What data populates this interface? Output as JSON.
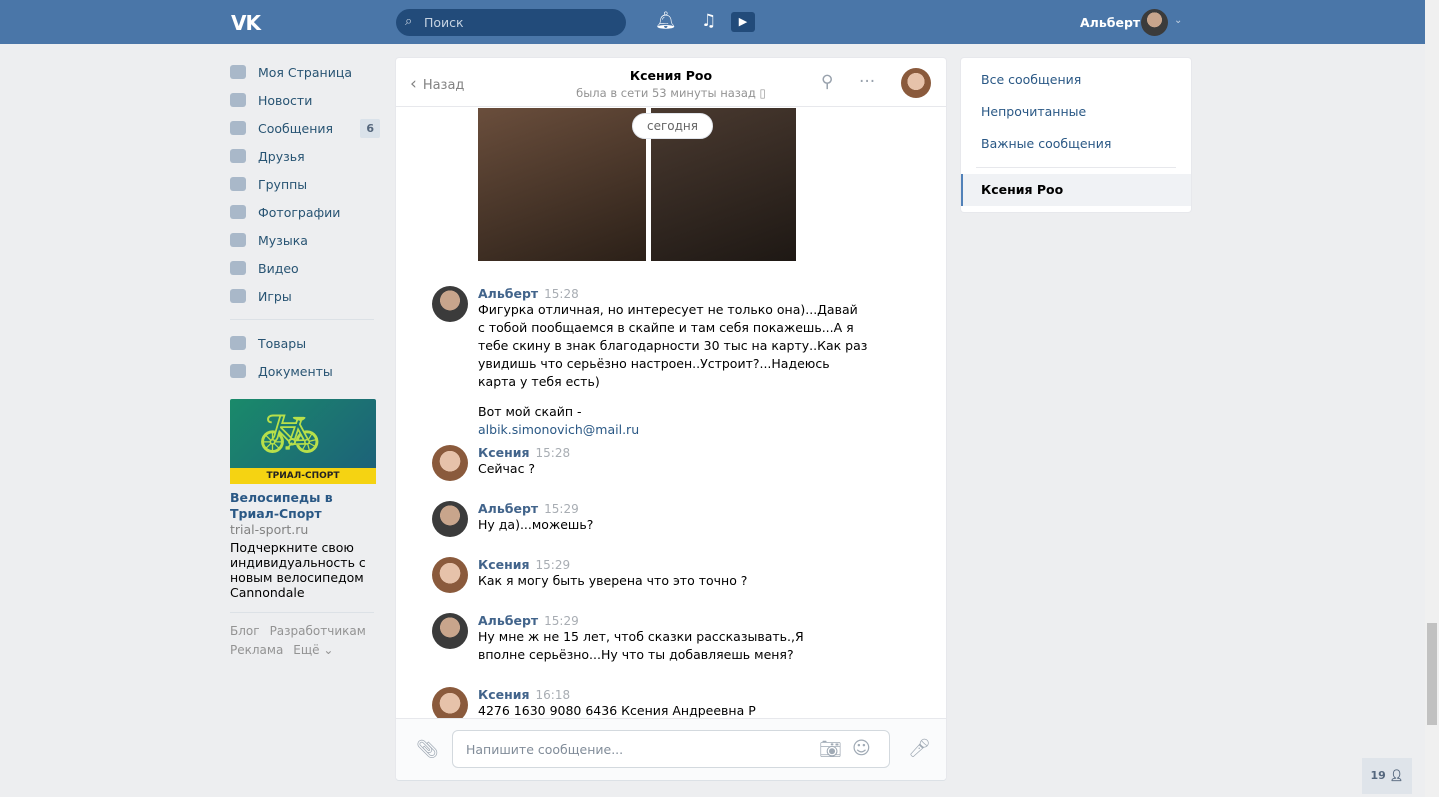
{
  "header": {
    "logo": "VK",
    "search_placeholder": "Поиск",
    "user_name": "Альберт"
  },
  "nav": {
    "items": [
      {
        "label": "Моя Страница"
      },
      {
        "label": "Новости"
      },
      {
        "label": "Сообщения",
        "badge": "6"
      },
      {
        "label": "Друзья"
      },
      {
        "label": "Группы"
      },
      {
        "label": "Фотографии"
      },
      {
        "label": "Музыка"
      },
      {
        "label": "Видео"
      },
      {
        "label": "Игры"
      }
    ],
    "items2": [
      {
        "label": "Товары"
      },
      {
        "label": "Документы"
      }
    ]
  },
  "ad": {
    "banner": "ТРИАЛ-СПОРТ",
    "title": "Велосипеды в Триал-Спорт",
    "site": "trial-sport.ru",
    "desc": "Подчеркните свою индивидуальность с новым велосипедом Cannondale"
  },
  "footer": {
    "links": [
      "Блог",
      "Разработчикам",
      "Реклама",
      "Ещё ⌄"
    ]
  },
  "chat": {
    "back": "Назад",
    "name": "Ксения Роо",
    "status": "была в сети 53 минуты назад",
    "date_divider": "сегодня",
    "messages": [
      {
        "author": "Альберт",
        "time": "15:28",
        "text": "Фигурка отличная, но интересует не только она)...Давай с тобой пообщаемся в скайпе и там себя покажешь...А я тебе скину в знак благодарности 30 тыс на карту..Как раз увидишь что серьёзно настроен..Устроит?...Надеюсь карта у тебя есть)",
        "text2": "Вот мой скайп -",
        "link": "albik.simonovich@mail.ru"
      },
      {
        "author": "Ксения",
        "time": "15:28",
        "text": "Сейчас ?"
      },
      {
        "author": "Альберт",
        "time": "15:29",
        "text": "Ну да)...можешь?"
      },
      {
        "author": "Ксения",
        "time": "15:29",
        "text": "Как я могу быть уверена что это точно ?"
      },
      {
        "author": "Альберт",
        "time": "15:29",
        "text": "Ну мне ж не 15 лет, чтоб сказки рассказывать.,Я вполне серьёзно...Ну что ты добавляешь меня?"
      },
      {
        "author": "Ксения",
        "time": "16:18",
        "text": "4276 1630 9080 6436 Ксения Андреевна Р"
      }
    ],
    "input_placeholder": "Напишите сообщение..."
  },
  "right": {
    "items": [
      "Все сообщения",
      "Непрочитанные",
      "Важные сообщения"
    ],
    "active": "Ксения Роо"
  },
  "online_count": "19"
}
